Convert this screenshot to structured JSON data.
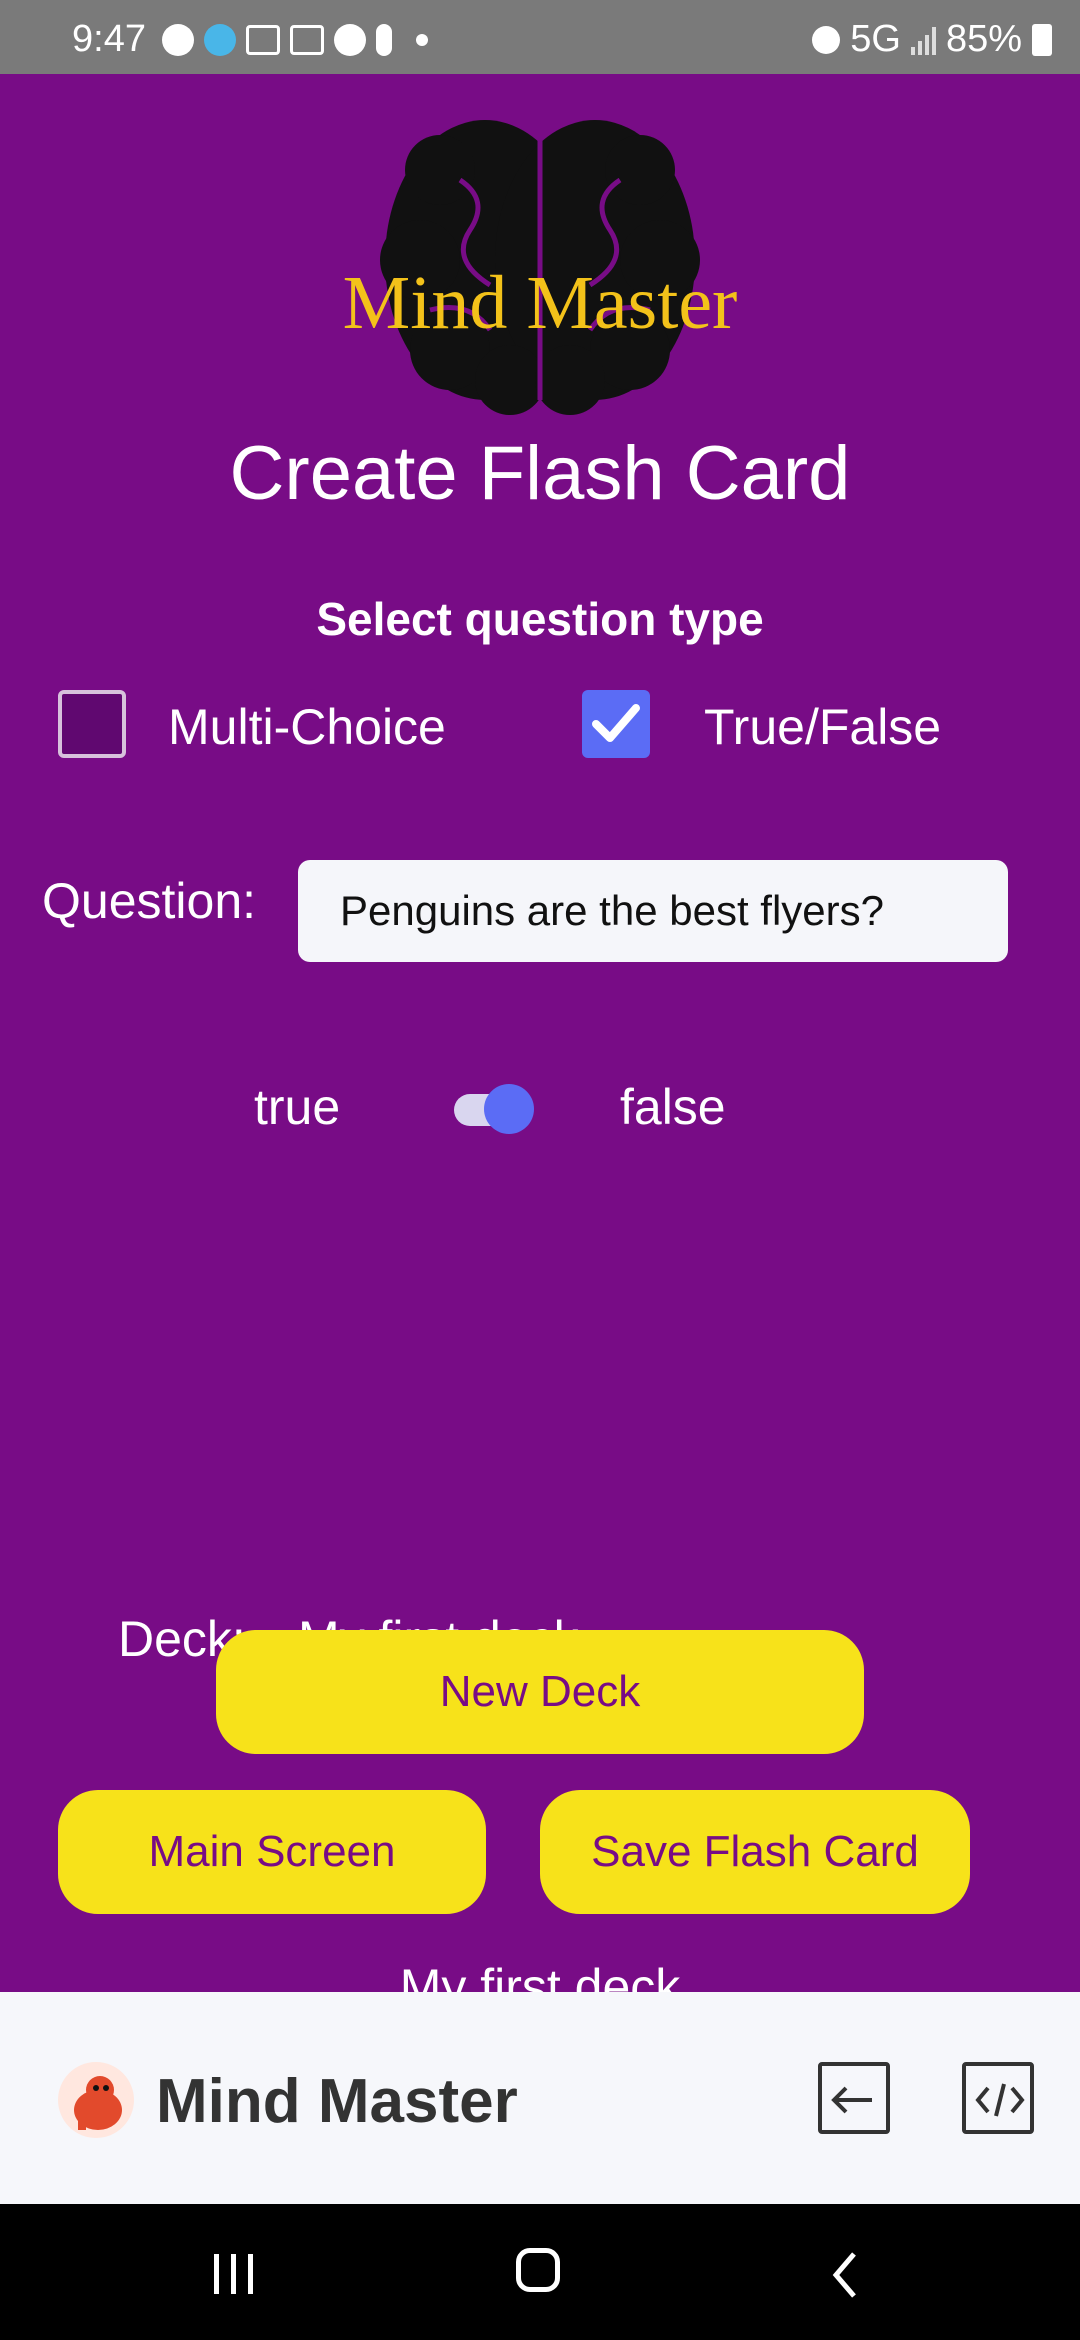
{
  "status_bar": {
    "time": "9:47",
    "network": "5G",
    "battery": "85%"
  },
  "logo": {
    "text": "Mind Master",
    "brain_color": "#111111",
    "text_color": "#f3c21a"
  },
  "page": {
    "title": "Create Flash Card",
    "section_label": "Select question type",
    "question_types": [
      {
        "label": "Multi-Choice",
        "checked": false
      },
      {
        "label": "True/False",
        "checked": true
      }
    ],
    "question_label": "Question:",
    "question_value": "Penguins are the best flyers?",
    "true_label": "true",
    "false_label": "false",
    "switch_on": true,
    "deck_label": "Deck:",
    "deck_value": "My first deck",
    "buttons": {
      "new_deck": "New Deck",
      "main_screen": "Main Screen",
      "save_flash_card": "Save Flash Card"
    },
    "deck_footer": "My first deck"
  },
  "bottom_bar": {
    "app_name": "Mind Master",
    "exit_icon": "exit-icon",
    "code_icon": "code-icon"
  },
  "colors": {
    "background": "#780c86",
    "button": "#f7e21a",
    "button_text": "#780c86",
    "accent": "#5b6cf5"
  }
}
